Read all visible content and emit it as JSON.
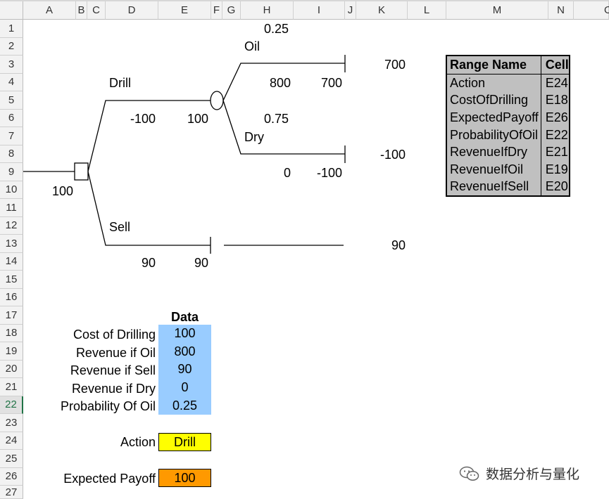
{
  "columns": [
    "A",
    "B",
    "C",
    "D",
    "E",
    "F",
    "G",
    "H",
    "I",
    "J",
    "K",
    "L",
    "M",
    "N",
    "O"
  ],
  "rows": [
    "1",
    "2",
    "3",
    "4",
    "5",
    "6",
    "7",
    "8",
    "9",
    "10",
    "11",
    "12",
    "13",
    "14",
    "15",
    "16",
    "17",
    "18",
    "19",
    "20",
    "21",
    "22",
    "23",
    "24",
    "25",
    "26",
    "27"
  ],
  "selected_row": "22",
  "tree": {
    "prob_oil": "0.25",
    "label_oil": "Oil",
    "label_drill": "Drill",
    "oil_revenue": "800",
    "oil_end": "700",
    "oil_payoff": "700",
    "drill_cost": "-100",
    "chance_value": "100",
    "prob_dry": "0.75",
    "label_dry": "Dry",
    "dry_payoff": "-100",
    "dry_revenue": "0",
    "dry_end": "-100",
    "root_value": "100",
    "label_sell": "Sell",
    "sell_payoff": "90",
    "sell_revenue": "90",
    "sell_end": "90"
  },
  "data_section": {
    "header": "Data",
    "labels": [
      "Cost of Drilling",
      "Revenue if Oil",
      "Revenue if Sell",
      "Revenue if Dry",
      "Probability Of Oil"
    ],
    "values": [
      "100",
      "800",
      "90",
      "0",
      "0.25"
    ],
    "action_label": "Action",
    "action_value": "Drill",
    "payoff_label": "Expected Payoff",
    "payoff_value": "100",
    "colors": {
      "data": "#99ccff",
      "action": "#ffff00",
      "payoff": "#ff9900"
    }
  },
  "range_table": {
    "headers": [
      "Range Name",
      "Cell"
    ],
    "rows": [
      [
        "Action",
        "E24"
      ],
      [
        "CostOfDrilling",
        "E18"
      ],
      [
        "ExpectedPayoff",
        "E26"
      ],
      [
        "ProbabilityOfOil",
        "E22"
      ],
      [
        "RevenueIfDry",
        "E21"
      ],
      [
        "RevenueIfOil",
        "E19"
      ],
      [
        "RevenueIfSell",
        "E20"
      ]
    ]
  },
  "watermark": {
    "text": "数据分析与量化",
    "icon": "wechat-icon"
  }
}
